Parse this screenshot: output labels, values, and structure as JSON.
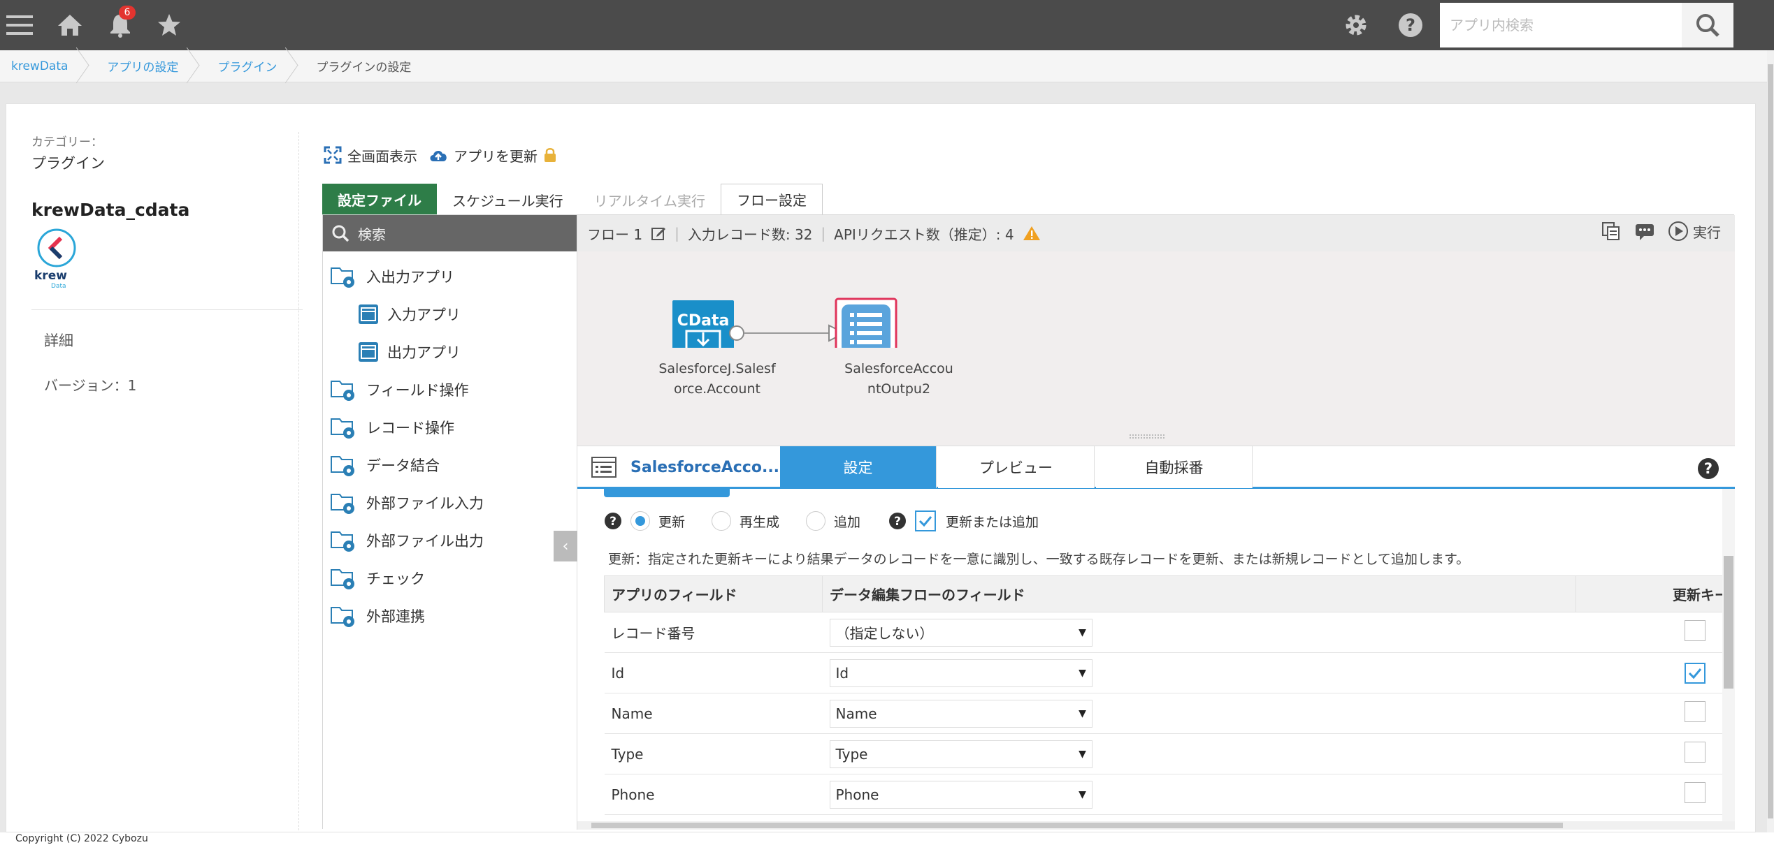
{
  "topbar": {
    "notification_count": "6",
    "search_placeholder": "アプリ内検索"
  },
  "breadcrumbs": [
    "krewData",
    "アプリの設定",
    "プラグイン",
    "プラグインの設定"
  ],
  "plugin": {
    "category_label": "カテゴリー：",
    "category_value": "プラグイン",
    "name": "krewData_cdata",
    "logo_text": "krew",
    "logo_sub": "Data",
    "details": "詳細",
    "version": "バージョン：1"
  },
  "toolbar": {
    "fullscreen": "全画面表示",
    "update_app": "アプリを更新"
  },
  "tabs": [
    {
      "label": "設定ファイル"
    },
    {
      "label": "スケジュール実行"
    },
    {
      "label": "リアルタイム実行"
    },
    {
      "label": "フロー設定"
    }
  ],
  "sidebar": {
    "search": "検索",
    "items": [
      {
        "label": "入出力アプリ"
      },
      {
        "label": "入力アプリ"
      },
      {
        "label": "出力アプリ"
      },
      {
        "label": "フィールド操作"
      },
      {
        "label": "レコード操作"
      },
      {
        "label": "データ結合"
      },
      {
        "label": "外部ファイル入力"
      },
      {
        "label": "外部ファイル出力"
      },
      {
        "label": "チェック"
      },
      {
        "label": "外部連携"
      }
    ]
  },
  "flow": {
    "name": "フロー 1",
    "input_records": "入力レコード数: 32",
    "api_requests": "APIリクエスト数（推定）: 4",
    "run": "実行",
    "node1_badge": "CData",
    "node1_label": [
      "SalesforceJ.Salesf",
      "orce.Account"
    ],
    "node2_label": [
      "SalesforceAccou",
      "ntOutpu2"
    ]
  },
  "panel": {
    "title": "SalesforceAcco...",
    "tabs": [
      "設定",
      "プレビュー",
      "自動採番"
    ],
    "options": [
      "更新",
      "再生成",
      "追加",
      "更新または追加"
    ],
    "description": "更新：指定された更新キーにより結果データのレコードを一意に識別し、一致する既存レコードを更新、または新規レコードとして追加します。",
    "columns": [
      "アプリのフィールド",
      "データ編集フローのフィールド",
      "更新キー"
    ],
    "rows": [
      {
        "field": "レコード番号",
        "flow": "（指定しない）",
        "key": false
      },
      {
        "field": "Id",
        "flow": "Id",
        "key": true
      },
      {
        "field": "Name",
        "flow": "Name",
        "key": false
      },
      {
        "field": "Type",
        "flow": "Type",
        "key": false
      },
      {
        "field": "Phone",
        "flow": "Phone",
        "key": false
      }
    ]
  },
  "footer": "Copyright (C) 2022 Cybozu",
  "colors": {
    "topbar": "#4b4b4b",
    "accent": "#3498db",
    "green": "#2e7d48",
    "node": "#1a8fc9",
    "selected_outline": "#e0335a"
  }
}
